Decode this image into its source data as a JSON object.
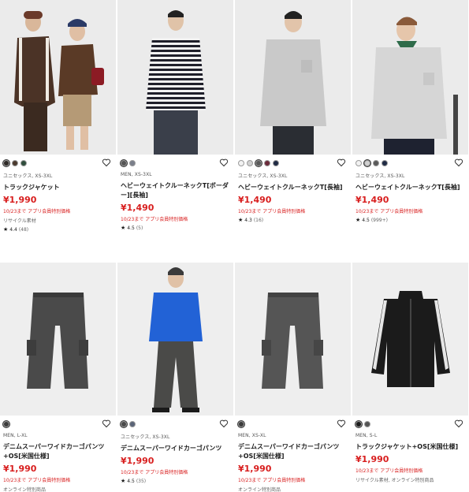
{
  "products": [
    {
      "gender": "ユニセックス, XS-3XL",
      "name": "トラックジャケット",
      "price": "¥1,990",
      "promo": "10/23まで アプリ会員特別価格",
      "note": "リサイクル素材",
      "rating": "4.4",
      "rating_count": "(48)",
      "swatches": [
        "#2e2a27",
        "#4a3a2e",
        "#2f4d3c"
      ]
    },
    {
      "gender": "MEN, XS-3XL",
      "name": "ヘビーウェイトクルーネックT[ボーダー][長袖]",
      "price": "¥1,490",
      "promo": "10/23まで アプリ会員特別価格",
      "rating": "4.5",
      "rating_count": "(5)",
      "swatches": [
        "#555555",
        "#7a7f8a"
      ]
    },
    {
      "gender": "ユニセックス, XS-3XL",
      "name": "ヘビーウェイトクルーネックT[長袖]",
      "price": "¥1,490",
      "promo": "10/23まで アプリ会員特別価格",
      "rating": "4.3",
      "rating_count": "(16)",
      "swatches": [
        "#f2f2f2",
        "#d0d0d0",
        "#5a5a5a",
        "#6b2a3a",
        "#1f2a44"
      ]
    },
    {
      "gender": "ユニセックス, XS-3XL",
      "name": "ヘビーウェイトクルーネックT[長袖]",
      "price": "¥1,490",
      "promo": "10/23まで アプリ会員特別価格",
      "rating": "4.5",
      "rating_count": "(999+)",
      "swatches": [
        "#f2f2f2",
        "#d0d0d0",
        "#5a5a5a",
        "#1f2a44"
      ]
    },
    {
      "gender": "MEN, L-XL",
      "name": "デニムスーパーワイドカーゴパンツ+OS[米国仕様]",
      "price": "¥1,990",
      "promo": "10/23まで アプリ会員特別価格",
      "note": "オンライン特別商品",
      "swatches": [
        "#3c3c3c"
      ]
    },
    {
      "gender": "ユニセックス, XS-3XL",
      "name": "デニムスーパーワイドカーゴパンツ",
      "price": "¥1,990",
      "promo": "10/23まで アプリ会員特別価格",
      "rating": "4.5",
      "rating_count": "(35)",
      "swatches": [
        "#4a4a4a",
        "#5a6478"
      ]
    },
    {
      "gender": "MEN, XS-XL",
      "name": "デニムスーパーワイドカーゴパンツ+OS[米国仕様]",
      "price": "¥1,990",
      "promo": "10/23まで アプリ会員特別価格",
      "note": "オンライン特別商品",
      "swatches": [
        "#3c3c3c"
      ]
    },
    {
      "gender": "MEN, S-L",
      "name": "トラックジャケット+OS[米国仕様]",
      "price": "¥1,990",
      "promo": "10/23まで アプリ会員特別価格",
      "note": "リサイクル素材, オンライン特別商品",
      "swatches": [
        "#1b1b1b",
        "#555555"
      ]
    }
  ],
  "colors": {
    "price": "#d81e1e",
    "promo": "#d81e1e"
  },
  "icons": {
    "favorite": "heart-outline-icon",
    "rating": "star-icon"
  }
}
